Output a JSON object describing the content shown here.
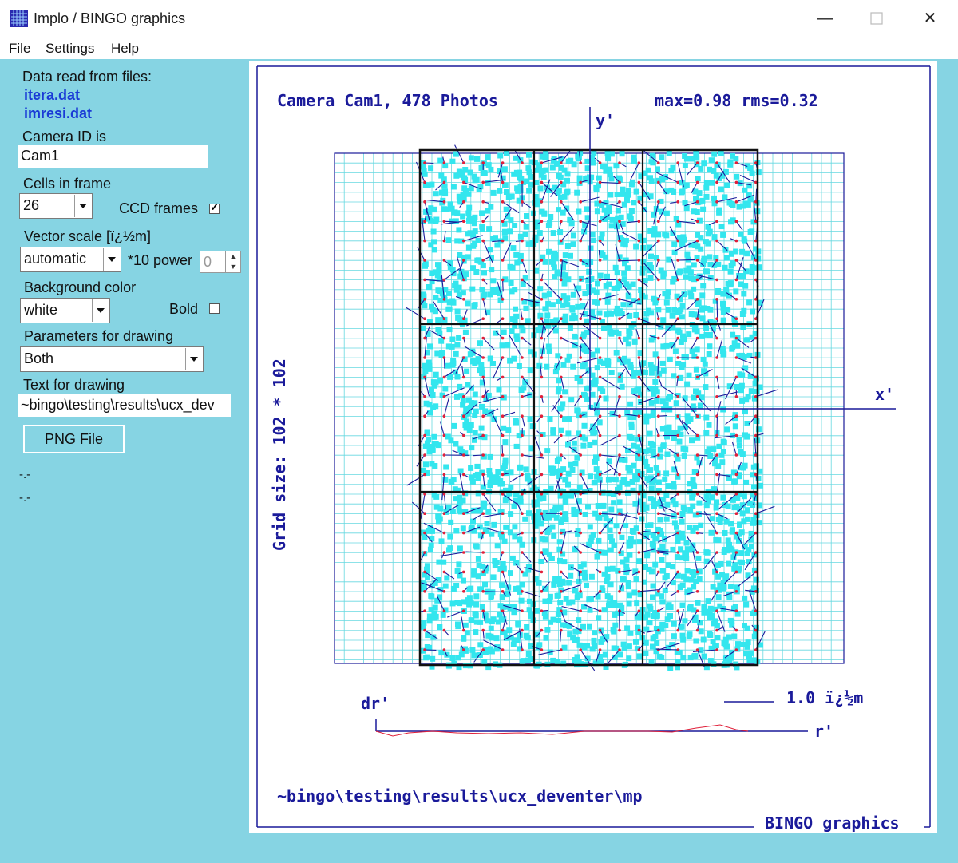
{
  "window": {
    "title": "Implo / BINGO graphics",
    "minimize_icon": "minimize-icon",
    "maximize_icon": "maximize-icon",
    "close_icon": "close-icon"
  },
  "menu": {
    "file": "File",
    "settings": "Settings",
    "help": "Help"
  },
  "panel": {
    "data_read_label": "Data read from files:",
    "file1": "itera.dat",
    "file2": "imresi.dat",
    "camera_id_label": "Camera ID is",
    "camera_id_value": "Cam1",
    "cells_label": "Cells in frame",
    "cells_value": "26",
    "ccd_frames_label": "CCD frames",
    "ccd_frames_checked": true,
    "vector_scale_label": "Vector scale [ï¿½m]",
    "vector_scale_value": "automatic",
    "power_label": "*10 power",
    "power_value": "0",
    "bg_color_label": "Background color",
    "bg_color_value": "white",
    "bold_label": "Bold",
    "bold_checked": false,
    "params_label": "Parameters for drawing",
    "params_value": "Both",
    "text_label": "Text for drawing",
    "text_value": "~bingo\\testing\\results\\ucx_dev",
    "png_button": "PNG File",
    "status1": "-.-",
    "status2": "-.-"
  },
  "plot": {
    "header_left": "Camera Cam1, 478 Photos",
    "header_right": "max=0.98 rms=0.32",
    "y_axis": "y'",
    "x_axis": "x'",
    "grid_size": "Grid size: 102 * 102",
    "scale_label": "1.0 ï¿½m",
    "dr_label": "dr'",
    "r_label": "r'",
    "footer_text": "~bingo\\testing\\results\\ucx_deventer\\mp",
    "brand": "BINGO graphics",
    "colors": {
      "navy": "#1a1a9a",
      "cyan_dots": "#33e6ee",
      "grid_cyan": "#66d8e0",
      "red_points": "#e0203a",
      "panel_bg": "#86d4e3"
    }
  }
}
